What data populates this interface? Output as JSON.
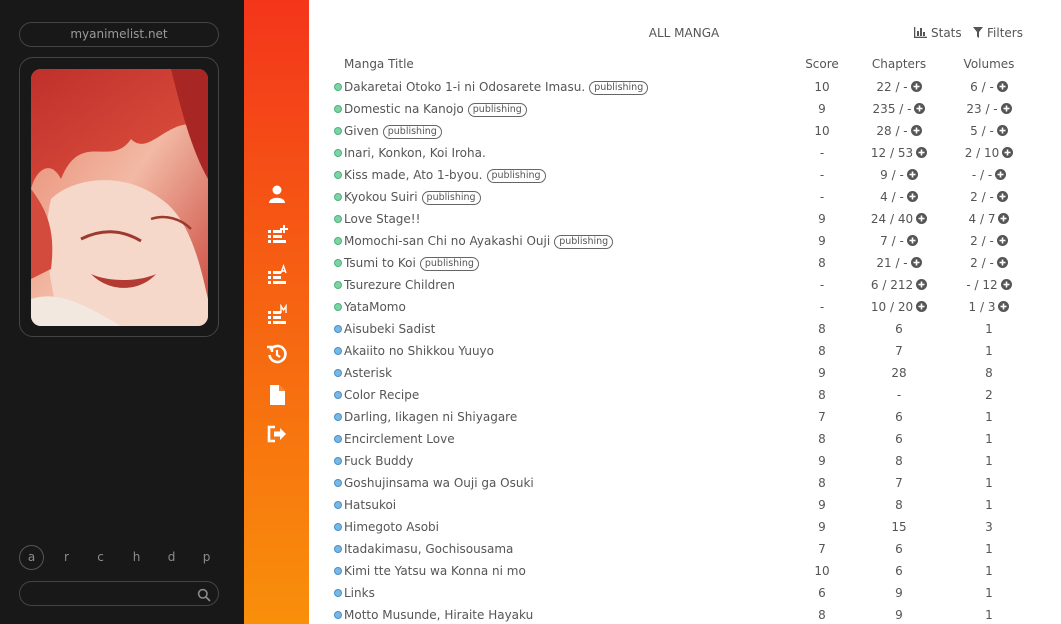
{
  "sidebar": {
    "site": "myanimelist.net",
    "letters": [
      {
        "label": "a",
        "active": true
      },
      {
        "label": "r",
        "active": false
      },
      {
        "label": "c",
        "active": false
      },
      {
        "label": "h",
        "active": false
      },
      {
        "label": "d",
        "active": false
      },
      {
        "label": "p",
        "active": false
      }
    ],
    "search": {
      "placeholder": "",
      "icon": "search-icon"
    }
  },
  "nav": [
    {
      "name": "profile-icon"
    },
    {
      "name": "list-add-icon"
    },
    {
      "name": "list-sort-alpha-icon"
    },
    {
      "name": "list-manga-icon"
    },
    {
      "name": "history-icon"
    },
    {
      "name": "document-icon"
    },
    {
      "name": "logout-icon"
    }
  ],
  "header": {
    "title": "ALL MANGA",
    "stats_label": "Stats",
    "filters_label": "Filters"
  },
  "columns": {
    "title": "Manga Title",
    "score": "Score",
    "chapters": "Chapters",
    "volumes": "Volumes"
  },
  "rows": [
    {
      "status": "green",
      "title": "Dakaretai Otoko 1-i ni Odosarete Imasu.",
      "badge": "publishing",
      "score": "10",
      "chapters": "22 / -",
      "volumes": "6 / -",
      "plus": true
    },
    {
      "status": "green",
      "title": "Domestic na Kanojo",
      "badge": "publishing",
      "score": "9",
      "chapters": "235 / -",
      "volumes": "23 / -",
      "plus": true
    },
    {
      "status": "green",
      "title": "Given",
      "badge": "publishing",
      "score": "10",
      "chapters": "28 / -",
      "volumes": "5 / -",
      "plus": true
    },
    {
      "status": "green",
      "title": "Inari, Konkon, Koi Iroha.",
      "badge": "",
      "score": "-",
      "chapters": "12 / 53",
      "volumes": "2 / 10",
      "plus": true
    },
    {
      "status": "green",
      "title": "Kiss made, Ato 1-byou.",
      "badge": "publishing",
      "score": "-",
      "chapters": "9 / -",
      "volumes": "- / -",
      "plus": true
    },
    {
      "status": "green",
      "title": "Kyokou Suiri",
      "badge": "publishing",
      "score": "-",
      "chapters": "4 / -",
      "volumes": "2 / -",
      "plus": true
    },
    {
      "status": "green",
      "title": "Love Stage!!",
      "badge": "",
      "score": "9",
      "chapters": "24 / 40",
      "volumes": "4 / 7",
      "plus": true
    },
    {
      "status": "green",
      "title": "Momochi-san Chi no Ayakashi Ouji",
      "badge": "publishing",
      "score": "9",
      "chapters": "7 / -",
      "volumes": "2 / -",
      "plus": true
    },
    {
      "status": "green",
      "title": "Tsumi to Koi",
      "badge": "publishing",
      "score": "8",
      "chapters": "21 / -",
      "volumes": "2 / -",
      "plus": true
    },
    {
      "status": "green",
      "title": "Tsurezure Children",
      "badge": "",
      "score": "-",
      "chapters": "6 / 212",
      "volumes": "- / 12",
      "plus": true
    },
    {
      "status": "green",
      "title": "YataMomo",
      "badge": "",
      "score": "-",
      "chapters": "10 / 20",
      "volumes": "1 / 3",
      "plus": true
    },
    {
      "status": "blue",
      "title": "Aisubeki Sadist",
      "badge": "",
      "score": "8",
      "chapters": "6",
      "volumes": "1",
      "plus": false
    },
    {
      "status": "blue",
      "title": "Akaiito no Shikkou Yuuyo",
      "badge": "",
      "score": "8",
      "chapters": "7",
      "volumes": "1",
      "plus": false
    },
    {
      "status": "blue",
      "title": "Asterisk",
      "badge": "",
      "score": "9",
      "chapters": "28",
      "volumes": "8",
      "plus": false
    },
    {
      "status": "blue",
      "title": "Color Recipe",
      "badge": "",
      "score": "8",
      "chapters": "-",
      "volumes": "2",
      "plus": false
    },
    {
      "status": "blue",
      "title": "Darling, Iikagen ni Shiyagare",
      "badge": "",
      "score": "7",
      "chapters": "6",
      "volumes": "1",
      "plus": false
    },
    {
      "status": "blue",
      "title": "Encirclement Love",
      "badge": "",
      "score": "8",
      "chapters": "6",
      "volumes": "1",
      "plus": false
    },
    {
      "status": "blue",
      "title": "Fuck Buddy",
      "badge": "",
      "score": "9",
      "chapters": "8",
      "volumes": "1",
      "plus": false
    },
    {
      "status": "blue",
      "title": "Goshujinsama wa Ouji ga Osuki",
      "badge": "",
      "score": "8",
      "chapters": "7",
      "volumes": "1",
      "plus": false
    },
    {
      "status": "blue",
      "title": "Hatsukoi",
      "badge": "",
      "score": "9",
      "chapters": "8",
      "volumes": "1",
      "plus": false
    },
    {
      "status": "blue",
      "title": "Himegoto Asobi",
      "badge": "",
      "score": "9",
      "chapters": "15",
      "volumes": "3",
      "plus": false
    },
    {
      "status": "blue",
      "title": "Itadakimasu, Gochisousama",
      "badge": "",
      "score": "7",
      "chapters": "6",
      "volumes": "1",
      "plus": false
    },
    {
      "status": "blue",
      "title": "Kimi tte Yatsu wa Konna ni mo",
      "badge": "",
      "score": "10",
      "chapters": "6",
      "volumes": "1",
      "plus": false
    },
    {
      "status": "blue",
      "title": "Links",
      "badge": "",
      "score": "6",
      "chapters": "9",
      "volumes": "1",
      "plus": false
    },
    {
      "status": "blue",
      "title": "Motto Musunde, Hiraite Hayaku",
      "badge": "",
      "score": "8",
      "chapters": "9",
      "volumes": "1",
      "plus": false
    }
  ],
  "colors": {
    "sidebar_bg": "#181818",
    "nav_top": "#f4351b",
    "nav_bottom": "#f98f0b",
    "status_publishing": "#7ed3a4",
    "status_completed": "#79b8e3"
  }
}
